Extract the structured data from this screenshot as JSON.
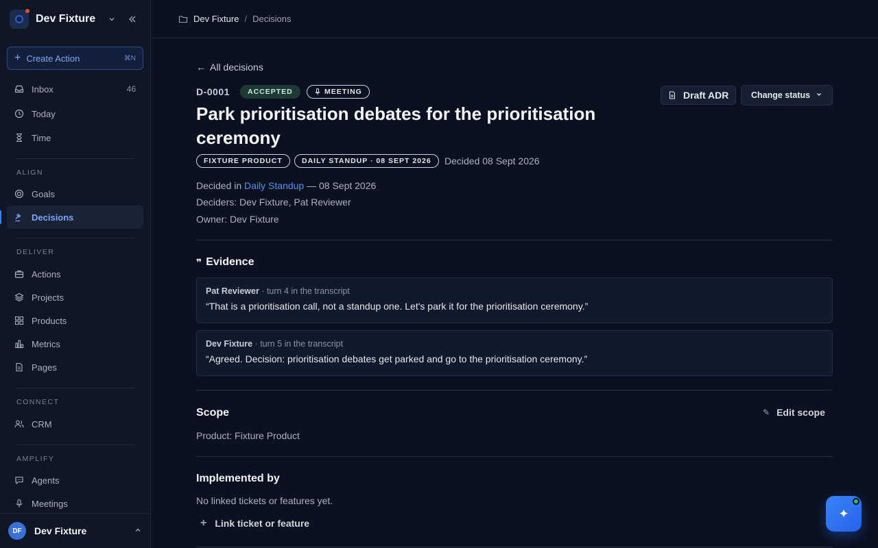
{
  "workspace": {
    "name": "Dev Fixture"
  },
  "sidebar": {
    "create_label": "Create Action",
    "create_shortcut": "⌘N",
    "top_items": [
      {
        "label": "Inbox",
        "count": "46",
        "icon": "inbox-icon"
      },
      {
        "label": "Today",
        "icon": "clock-icon"
      },
      {
        "label": "Time",
        "icon": "hourglass-icon"
      }
    ],
    "sections": {
      "align": "ALIGN",
      "deliver": "DELIVER",
      "connect": "CONNECT",
      "amplify": "AMPLIFY"
    },
    "align_items": [
      {
        "label": "Goals",
        "icon": "target-icon"
      },
      {
        "label": "Decisions",
        "icon": "gavel-icon",
        "active": true
      }
    ],
    "deliver_items": [
      {
        "label": "Actions",
        "icon": "briefcase-icon"
      },
      {
        "label": "Projects",
        "icon": "layers-icon"
      },
      {
        "label": "Products",
        "icon": "grid-icon"
      },
      {
        "label": "Metrics",
        "icon": "bar-chart-icon"
      },
      {
        "label": "Pages",
        "icon": "file-icon"
      }
    ],
    "connect_items": [
      {
        "label": "CRM",
        "icon": "users-icon"
      }
    ],
    "amplify_items": [
      {
        "label": "Agents",
        "icon": "chat-icon"
      },
      {
        "label": "Meetings",
        "icon": "mic-icon"
      }
    ],
    "user": {
      "initials": "DF",
      "name": "Dev Fixture"
    }
  },
  "breadcrumb": {
    "root": "Dev Fixture",
    "separator": "/",
    "current": "Decisions"
  },
  "decision": {
    "back_label": "All decisions",
    "id": "D-0001",
    "status": "ACCEPTED",
    "source": "MEETING",
    "title": "Park prioritisation debates for the prioritisation ceremony",
    "tags": [
      "FIXTURE PRODUCT",
      "DAILY STANDUP · 08 SEPT 2026"
    ],
    "decided_label": "Decided 08 Sept 2026",
    "decided_in_prefix": "Decided in",
    "decided_in_link": "Daily Standup",
    "decided_in_suffix": "— 08 Sept 2026",
    "deciders": "Deciders: Dev Fixture, Pat Reviewer",
    "owner": "Owner: Dev Fixture",
    "draft_adr_label": "Draft ADR",
    "change_status_label": "Change status"
  },
  "evidence": {
    "heading": "Evidence",
    "items": [
      {
        "speaker": "Pat Reviewer",
        "turn": "· turn 4 in the transcript",
        "quote": "“That is a prioritisation call, not a standup one. Let's park it for the prioritisation ceremony.”"
      },
      {
        "speaker": "Dev Fixture",
        "turn": "· turn 5 in the transcript",
        "quote": "“Agreed. Decision: prioritisation debates get parked and go to the prioritisation ceremony.”"
      }
    ]
  },
  "scope": {
    "heading": "Scope",
    "edit_label": "Edit scope",
    "value": "Product: Fixture Product"
  },
  "implemented": {
    "heading": "Implemented by",
    "empty": "No linked tickets or features yet.",
    "link_label": "Link ticket or feature"
  },
  "colors": {
    "accent": "#3b82f6",
    "background": "#0b1120",
    "sidebar": "#0f1626"
  }
}
